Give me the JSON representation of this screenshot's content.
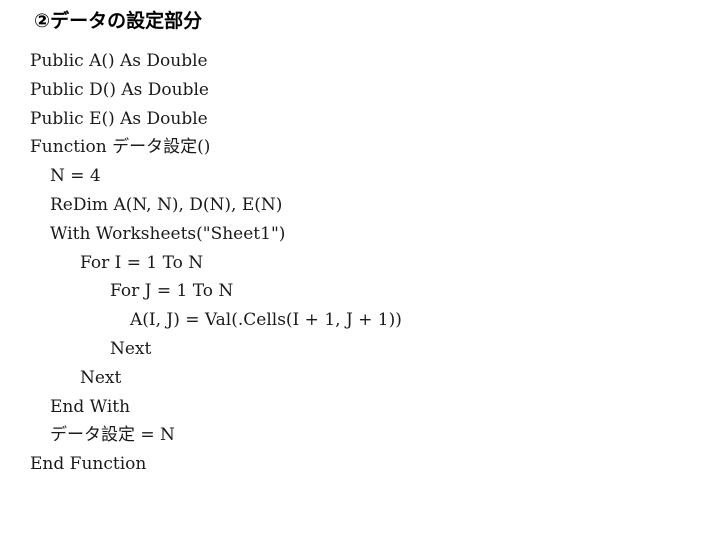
{
  "title": "②データの設定部分",
  "code": {
    "lines": [
      {
        "text": "Public A() As Double",
        "indent": 0
      },
      {
        "text": "Public D() As Double",
        "indent": 0
      },
      {
        "text": "Public E() As Double",
        "indent": 0
      },
      {
        "text": "Function データ設定()",
        "indent": 0
      },
      {
        "text": "N = 4",
        "indent": 1
      },
      {
        "text": "ReDim A(N, N), D(N), E(N)",
        "indent": 1
      },
      {
        "text": "With Worksheets(\"Sheet1\")",
        "indent": 1
      },
      {
        "text": "For I = 1 To N",
        "indent": 2
      },
      {
        "text": "For J = 1 To N",
        "indent": 3
      },
      {
        "text": "A(I, J) = Val(.Cells(I + 1, J + 1))",
        "indent": 4
      },
      {
        "text": "Next",
        "indent": 3
      },
      {
        "text": "Next",
        "indent": 2
      },
      {
        "text": "End With",
        "indent": 1
      },
      {
        "text": "データ設定 = N",
        "indent": 1
      },
      {
        "text": "End Function",
        "indent": 0
      }
    ]
  }
}
